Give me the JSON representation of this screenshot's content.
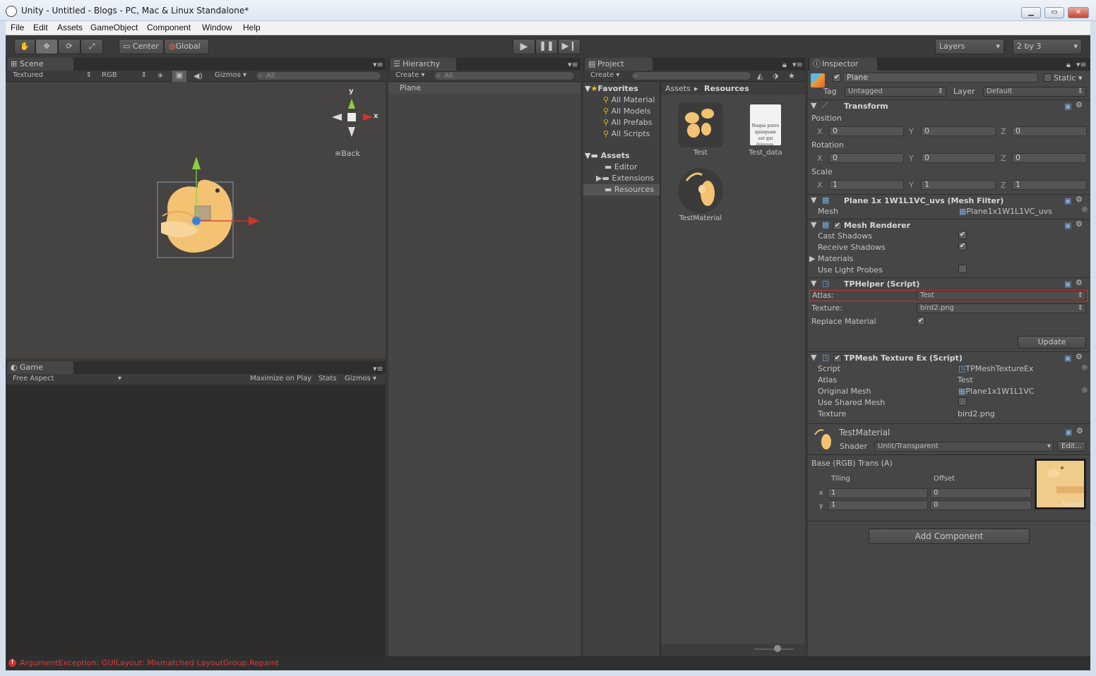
{
  "window": {
    "title": "Unity - Untitled - Blogs - PC, Mac & Linux Standalone*"
  },
  "menu": [
    "File",
    "Edit",
    "Assets",
    "GameObject",
    "Component",
    "Window",
    "Help"
  ],
  "toolbar": {
    "center": "Center",
    "global": "Global",
    "layers": "Layers",
    "layout": "2 by 3"
  },
  "scene": {
    "tab": "Scene",
    "render_mode": "Textured",
    "channel": "RGB",
    "gizmos": "Gizmos",
    "search": "All",
    "back": "Back",
    "axis_x": "x",
    "axis_y": "y"
  },
  "game": {
    "tab": "Game",
    "aspect": "Free Aspect",
    "maximize": "Maximize on Play",
    "stats": "Stats",
    "gizmos": "Gizmos"
  },
  "hierarchy": {
    "tab": "Hierarchy",
    "create": "Create",
    "search": "All",
    "items": [
      "Plane"
    ]
  },
  "project": {
    "tab": "Project",
    "create": "Create",
    "favorites_label": "Favorites",
    "favorites": [
      "All Material",
      "All Models",
      "All Prefabs",
      "All Scripts"
    ],
    "assets_label": "Assets",
    "folders": [
      "Editor",
      "Extensions",
      "Resources"
    ],
    "breadcrumb_root": "Assets",
    "breadcrumb_current": "Resources",
    "files": [
      {
        "name": "Test",
        "kind": "atlas"
      },
      {
        "name": "Test_data",
        "kind": "text"
      },
      {
        "name": "TestMaterial",
        "kind": "material"
      }
    ],
    "doc_preview": "Neque porro quisquam est qui dolorem."
  },
  "inspector": {
    "tab": "Inspector",
    "object_name": "Plane",
    "static": "Static",
    "tag_label": "Tag",
    "tag": "Untagged",
    "layer_label": "Layer",
    "layer": "Default",
    "transform": {
      "title": "Transform",
      "rows": [
        {
          "label": "Position",
          "x": "0",
          "y": "0",
          "z": "0"
        },
        {
          "label": "Rotation",
          "x": "0",
          "y": "0",
          "z": "0"
        },
        {
          "label": "Scale",
          "x": "1",
          "y": "1",
          "z": "1"
        }
      ],
      "axis_x": "X",
      "axis_y": "Y",
      "axis_z": "Z"
    },
    "mesh_filter": {
      "title": "Plane 1x 1W1L1VC_uvs (Mesh Filter)",
      "mesh_label": "Mesh",
      "mesh": "Plane1x1W1L1VC_uvs"
    },
    "mesh_renderer": {
      "title": "Mesh Renderer",
      "props": [
        {
          "label": "Cast Shadows",
          "checked": true
        },
        {
          "label": "Receive Shadows",
          "checked": true
        },
        {
          "label": "Materials",
          "foldout": true
        },
        {
          "label": "Use Light Probes",
          "checked": false
        }
      ]
    },
    "tphelper": {
      "title": "TPHelper (Script)",
      "atlas_label": "Atlas:",
      "atlas": "Test",
      "texture_label": "Texture:",
      "texture": "bird2.png",
      "replace_label": "Replace Material",
      "update": "Update"
    },
    "tpmesh": {
      "title": "TPMesh Texture Ex (Script)",
      "rows": [
        {
          "label": "Script",
          "value": "TPMeshTextureEx"
        },
        {
          "label": "Atlas",
          "value": "Test"
        },
        {
          "label": "Original Mesh",
          "value": "Plane1x1W1L1VC"
        },
        {
          "label": "Use Shared Mesh",
          "value": ""
        },
        {
          "label": "Texture",
          "value": "bird2.png"
        }
      ]
    },
    "material": {
      "name": "TestMaterial",
      "shader_label": "Shader",
      "shader": "Unlit/Transparent",
      "edit": "Edit...",
      "base_label": "Base (RGB) Trans (A)",
      "tiling": "Tiling",
      "offset": "Offset",
      "tx": "1",
      "ty": "1",
      "ox": "0",
      "oy": "0",
      "select": "Select",
      "row_x": "x",
      "row_y": "y"
    },
    "add_component": "Add Component"
  },
  "status": {
    "error": "ArgumentException: GUILayout: Mismatched LayoutGroup.Repaint"
  }
}
